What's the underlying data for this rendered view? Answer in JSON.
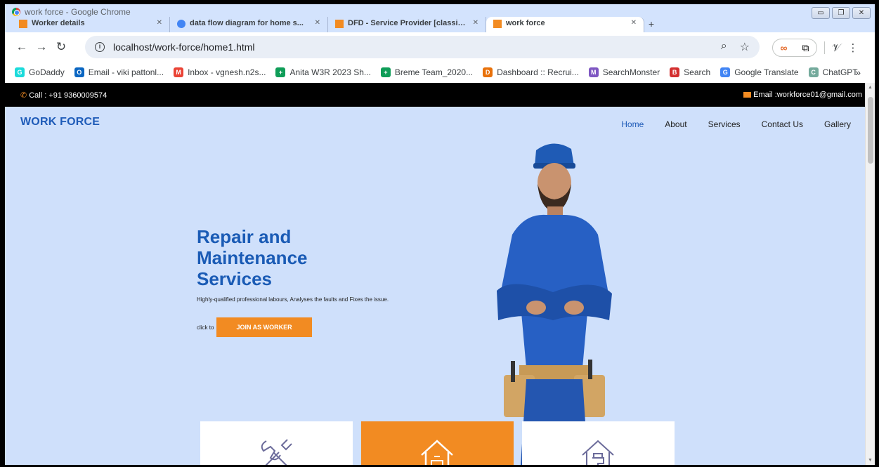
{
  "window": {
    "title": "work force - Google Chrome"
  },
  "tabs": [
    {
      "label": "Worker details",
      "active": false
    },
    {
      "label": "data flow diagram for home s...",
      "active": false
    },
    {
      "label": "DFD - Service Provider [classic...",
      "active": false
    },
    {
      "label": "work force",
      "active": true
    }
  ],
  "toolbar": {
    "url": "localhost/work-force/home1.html"
  },
  "bookmarks": [
    {
      "label": "GoDaddy",
      "color": "#1bdbdb",
      "glyph": "G"
    },
    {
      "label": "Email - viki pattonl...",
      "color": "#0a66c2",
      "glyph": "O"
    },
    {
      "label": "Inbox - vgnesh.n2s...",
      "color": "#ea4335",
      "glyph": "M"
    },
    {
      "label": "Anita W3R 2023 Sh...",
      "color": "#0f9d58",
      "glyph": "+"
    },
    {
      "label": "Breme Team_2020...",
      "color": "#0f9d58",
      "glyph": "+"
    },
    {
      "label": "Dashboard :: Recrui...",
      "color": "#e8710a",
      "glyph": "D"
    },
    {
      "label": "SearchMonster",
      "color": "#7e57c2",
      "glyph": "M"
    },
    {
      "label": "Search",
      "color": "#d32f2f",
      "glyph": "B"
    },
    {
      "label": "Google Translate",
      "color": "#4285f4",
      "glyph": "G"
    },
    {
      "label": "ChatGPT",
      "color": "#74aa9c",
      "glyph": "C"
    }
  ],
  "site": {
    "call": "Call : +91 9360009574",
    "email": "Email :workforce01@gmail.com",
    "brand": "WORK FORCE",
    "nav": [
      {
        "label": "Home",
        "active": true
      },
      {
        "label": "About",
        "active": false
      },
      {
        "label": "Services",
        "active": false
      },
      {
        "label": "Contact Us",
        "active": false
      },
      {
        "label": "Gallery",
        "active": false
      }
    ],
    "hero": {
      "title_line1": "Repair and",
      "title_line2": "Maintenance",
      "title_line3": "Services",
      "subtitle": "Highly-qualified professional labours, Analyses the faults and Fixes the issue.",
      "cta_prefix": "click to",
      "cta_button": "JOIN AS WORKER"
    },
    "cards": [
      {
        "icon": "tools-icon",
        "style": "white"
      },
      {
        "icon": "house-repair-icon",
        "style": "orange"
      },
      {
        "icon": "house-plumbing-icon",
        "style": "white"
      }
    ]
  },
  "colors": {
    "accent": "#f28b22",
    "brand": "#1e5bb8",
    "hero_bg": "#cfe0fb"
  }
}
